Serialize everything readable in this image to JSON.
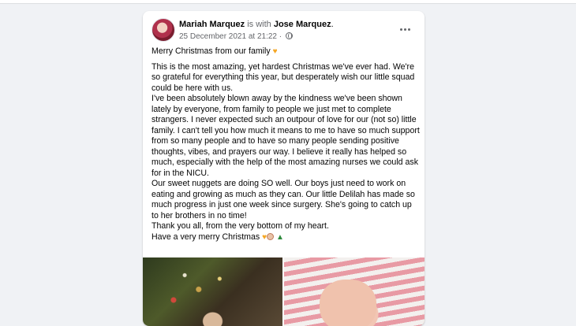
{
  "post": {
    "author": "Mariah Marquez",
    "with_text": " is with ",
    "tagged": "Jose Marquez",
    "tag_suffix": ".",
    "timestamp": "25 December 2021 at 21:22 · ",
    "privacy_icon": "globe-icon",
    "more_icon": "more-options-icon",
    "lines": [
      "Merry Christmas from our family",
      "This is the most amazing, yet hardest Christmas we've ever had. We're so grateful for everything this year, but desperately wish our little squad could be here with us.",
      "I've been absolutely blown away by the kindness we've been shown lately by everyone, from family to people we just met to complete strangers. I never expected such an outpour of love for our (not so) little family. I can't tell you how much it means to me to have so much support from so many people and to have so many people sending positive thoughts, vibes, and prayers our way. I believe it really has helped so much, especially with the help of the most amazing nurses we could ask for in the NICU.",
      "Our sweet nuggets are doing SO well. Our boys just need to work on eating and growing as much as they can. Our little Delilah has made so much progress in just one week since surgery. She's going to catch up to her brothers in no time!",
      "Thank you all, from the very bottom of my heart.",
      "Have a very merry Christmas"
    ],
    "emoji": {
      "heart": "heart-emoji",
      "bauble": "bauble-emoji",
      "tree": "tree-emoji"
    },
    "photos": [
      "christmas-tree-photo",
      "newborn-photo"
    ],
    "colors": {
      "background": "#f0f2f5",
      "card": "#ffffff",
      "secondary_text": "#65676b",
      "heart": "#f5a623"
    }
  }
}
